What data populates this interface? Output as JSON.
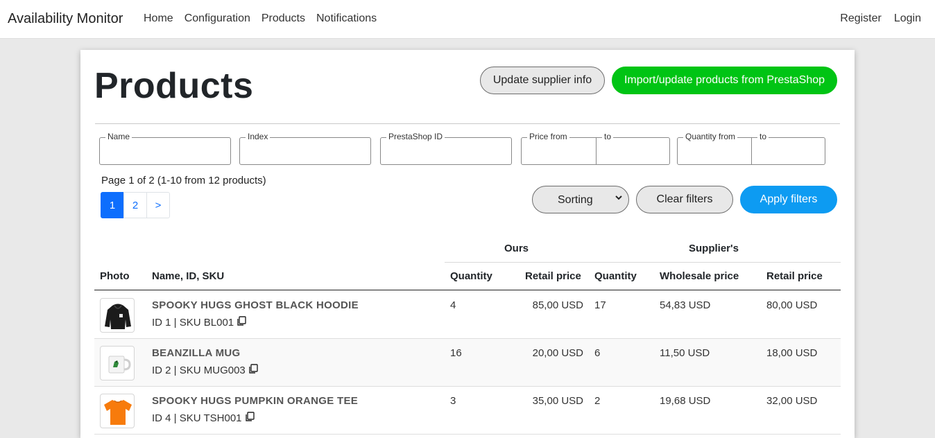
{
  "navbar": {
    "brand": "Availability Monitor",
    "left_links": [
      "Home",
      "Configuration",
      "Products",
      "Notifications"
    ],
    "right_links": [
      "Register",
      "Login"
    ]
  },
  "page": {
    "title": "Products",
    "update_supplier_label": "Update supplier info",
    "import_label": "Import/update products from PrestaShop"
  },
  "filters": {
    "name_legend": "Name",
    "index_legend": "Index",
    "prestashop_id_legend": "PrestaShop ID",
    "price_from_legend": "Price from",
    "price_to_legend": "to",
    "quantity_from_legend": "Quantity from",
    "quantity_to_legend": "to",
    "sorting_label": "Sorting",
    "clear_label": "Clear filters",
    "apply_label": "Apply filters"
  },
  "pagination": {
    "info": "Page 1 of 2 (1-10 from 12 products)",
    "pages": [
      "1",
      "2",
      ">"
    ]
  },
  "table": {
    "group_ours": "Ours",
    "group_supplier": "Supplier's",
    "headers": {
      "photo": "Photo",
      "name": "Name, ID, SKU",
      "quantity": "Quantity",
      "retail_price": "Retail price",
      "supplier_quantity": "Quantity",
      "wholesale_price": "Wholesale price",
      "supplier_retail_price": "Retail price"
    },
    "rows": [
      {
        "name": "SPOOKY HUGS GHOST BLACK HOODIE",
        "id_sku": "ID 1 | SKU BL001",
        "quantity": "4",
        "retail_price": "85,00 USD",
        "supplier_quantity": "17",
        "wholesale_price": "54,83 USD",
        "supplier_retail_price": "80,00 USD",
        "photo": "black-hoodie"
      },
      {
        "name": "BEANZILLA MUG",
        "id_sku": "ID 2 | SKU MUG003",
        "quantity": "16",
        "retail_price": "20,00 USD",
        "supplier_quantity": "6",
        "wholesale_price": "11,50 USD",
        "supplier_retail_price": "18,00 USD",
        "photo": "white-mug"
      },
      {
        "name": "SPOOKY HUGS PUMPKIN ORANGE TEE",
        "id_sku": "ID 4 | SKU TSH001",
        "quantity": "3",
        "retail_price": "35,00 USD",
        "supplier_quantity": "2",
        "wholesale_price": "19,68 USD",
        "supplier_retail_price": "32,00 USD",
        "photo": "orange-tee"
      }
    ]
  },
  "colors": {
    "green_button": "#00c414",
    "blue_button": "#0d9bf2",
    "active_page": "#0d6efd"
  }
}
